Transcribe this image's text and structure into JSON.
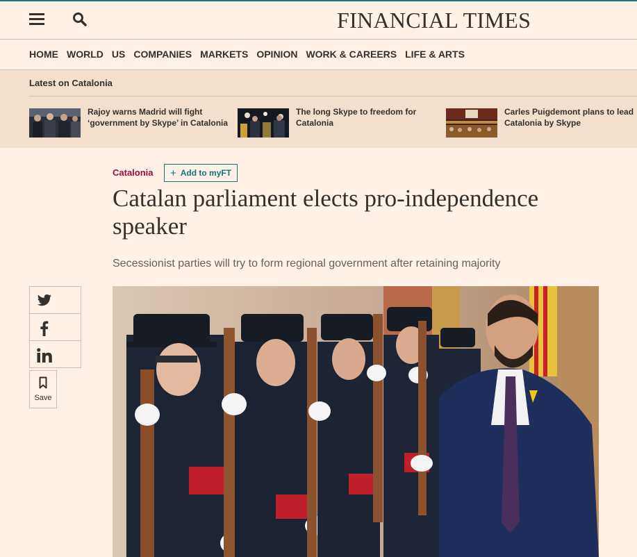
{
  "brand": {
    "name": "FINANCIAL TIMES"
  },
  "nav": {
    "items": [
      "HOME",
      "WORLD",
      "US",
      "COMPANIES",
      "MARKETS",
      "OPINION",
      "WORK & CAREERS",
      "LIFE & ARTS"
    ]
  },
  "latest": {
    "title": "Latest on Catalonia",
    "stories": [
      {
        "headline": "Rajoy warns Madrid will fight ‘government by Skype’ in Catalonia"
      },
      {
        "headline": "The long Skype to freedom for Catalonia"
      },
      {
        "headline": "Carles Puigdemont plans to lead Catalonia by Skype"
      }
    ]
  },
  "article": {
    "topic": "Catalonia",
    "myft_label": "Add to myFT",
    "title": "Catalan parliament elects pro-independence speaker",
    "standfirst": "Secessionist parties will try to form regional government after retaining majority"
  },
  "share": {
    "save_label": "Save",
    "icons": [
      "twitter-icon",
      "facebook-icon",
      "linkedin-icon",
      "bookmark-icon"
    ]
  },
  "colors": {
    "background": "#fff1e5",
    "strip": "#f2dfce",
    "topic": "#990f3d",
    "accent": "#0d7680"
  }
}
